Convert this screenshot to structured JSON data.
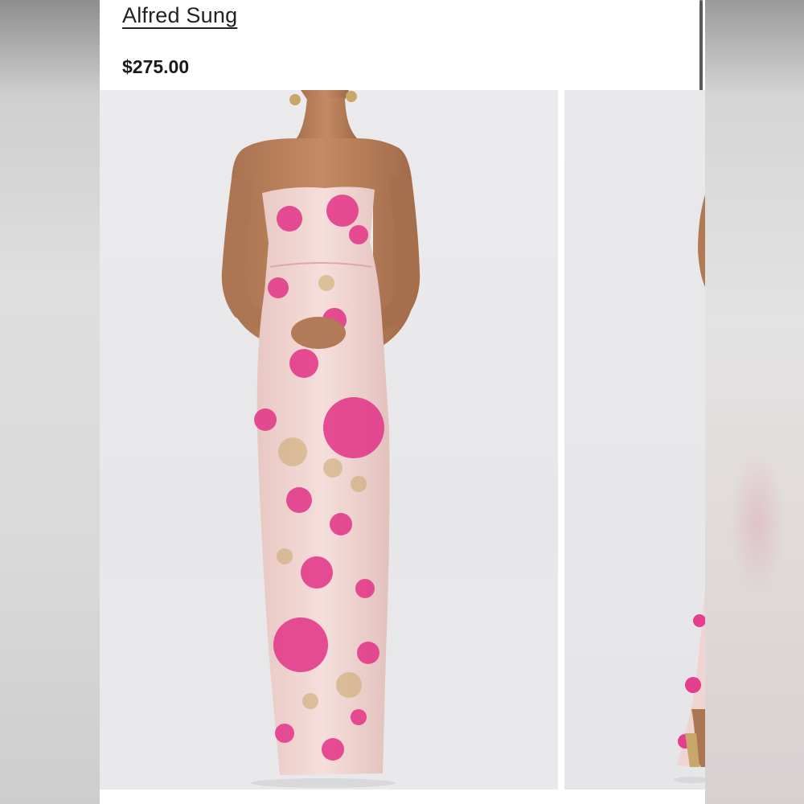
{
  "product": {
    "brand": "Alfred Sung",
    "price": "$275.00"
  },
  "gallery": {
    "images": [
      {
        "name": "product-photo-front",
        "icon": "model-wearing-strapless-floral-gown"
      },
      {
        "name": "product-photo-side",
        "icon": "model-side-view-partial"
      }
    ]
  },
  "colors": {
    "dress_base": "#f1d7d4",
    "dress_floral": "#e33f8c",
    "accent_gold": "#c9a76a",
    "text": "#222222"
  }
}
